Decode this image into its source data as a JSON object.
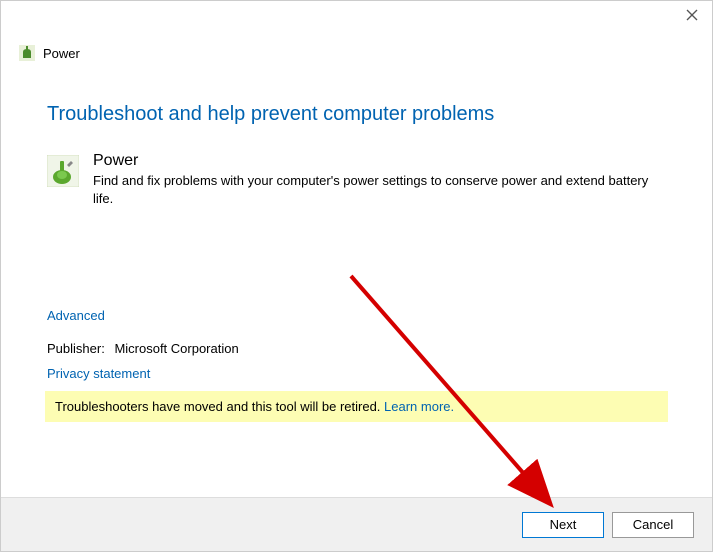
{
  "header": {
    "title": "Power"
  },
  "main": {
    "heading": "Troubleshoot and help prevent computer problems",
    "item": {
      "title": "Power",
      "description": "Find and fix problems with your computer's power settings to conserve power and extend battery life."
    },
    "advanced_label": "Advanced",
    "publisher_label": "Publisher:",
    "publisher_value": "Microsoft Corporation",
    "privacy_label": "Privacy statement",
    "notice_text": "Troubleshooters have moved and this tool will be retired. ",
    "notice_link": "Learn more."
  },
  "footer": {
    "next_label": "Next",
    "cancel_label": "Cancel"
  }
}
